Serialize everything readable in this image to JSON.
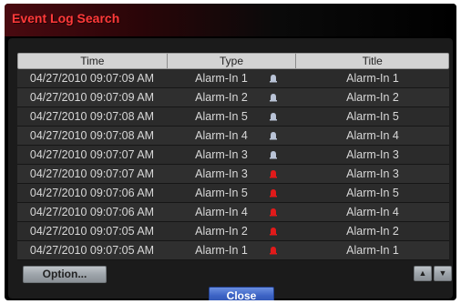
{
  "window": {
    "title": "Event Log Search"
  },
  "table": {
    "headers": {
      "time": "Time",
      "type": "Type",
      "title": "Title"
    },
    "rows": [
      {
        "time": "04/27/2010  09:07:09 AM",
        "type": "Alarm-In 1",
        "title": "Alarm-In 1",
        "status": "off"
      },
      {
        "time": "04/27/2010  09:07:09 AM",
        "type": "Alarm-In 2",
        "title": "Alarm-In 2",
        "status": "off"
      },
      {
        "time": "04/27/2010  09:07:08 AM",
        "type": "Alarm-In 5",
        "title": "Alarm-In 5",
        "status": "off"
      },
      {
        "time": "04/27/2010  09:07:08 AM",
        "type": "Alarm-In 4",
        "title": "Alarm-In 4",
        "status": "off"
      },
      {
        "time": "04/27/2010  09:07:07 AM",
        "type": "Alarm-In 3",
        "title": "Alarm-In 3",
        "status": "off"
      },
      {
        "time": "04/27/2010  09:07:07 AM",
        "type": "Alarm-In 3",
        "title": "Alarm-In 3",
        "status": "on"
      },
      {
        "time": "04/27/2010  09:07:06 AM",
        "type": "Alarm-In 5",
        "title": "Alarm-In 5",
        "status": "on"
      },
      {
        "time": "04/27/2010  09:07:06 AM",
        "type": "Alarm-In 4",
        "title": "Alarm-In 4",
        "status": "on"
      },
      {
        "time": "04/27/2010  09:07:05 AM",
        "type": "Alarm-In 2",
        "title": "Alarm-In 2",
        "status": "on"
      },
      {
        "time": "04/27/2010  09:07:05 AM",
        "type": "Alarm-In 1",
        "title": "Alarm-In 1",
        "status": "on"
      }
    ]
  },
  "buttons": {
    "option": "Option...",
    "close": "Close",
    "scroll_up_icon": "triangle-up-icon",
    "scroll_down_icon": "triangle-down-icon"
  },
  "colors": {
    "title": "#ff3a3a",
    "bell_off": "#b9c3d6",
    "bell_on": "#e11a1a",
    "close_button": "#3c63c4"
  }
}
